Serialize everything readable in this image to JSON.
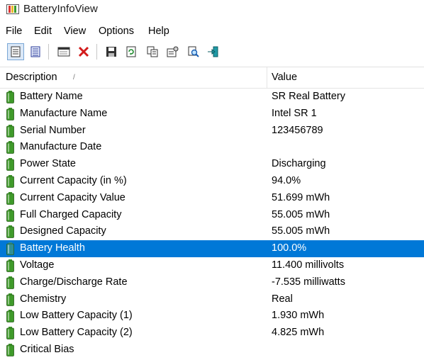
{
  "window": {
    "title": "BatteryInfoView"
  },
  "menu": [
    "File",
    "Edit",
    "View",
    "Options",
    "Help"
  ],
  "toolbar_icons": [
    "html-report-icon",
    "text-report-icon",
    "properties-window-icon",
    "delete-icon",
    "save-icon",
    "refresh-icon",
    "copy-icon",
    "properties-icon",
    "find-icon",
    "exit-icon"
  ],
  "columns": {
    "description": "Description",
    "value": "Value",
    "sort_indicator": "/"
  },
  "rows": [
    {
      "description": "Battery Name",
      "value": "SR Real Battery",
      "selected": false
    },
    {
      "description": "Manufacture Name",
      "value": "Intel SR 1",
      "selected": false
    },
    {
      "description": "Serial Number",
      "value": "123456789",
      "selected": false
    },
    {
      "description": "Manufacture Date",
      "value": "",
      "selected": false
    },
    {
      "description": "Power State",
      "value": "Discharging",
      "selected": false
    },
    {
      "description": "Current Capacity (in %)",
      "value": "94.0%",
      "selected": false
    },
    {
      "description": "Current Capacity Value",
      "value": "51.699 mWh",
      "selected": false
    },
    {
      "description": "Full Charged Capacity",
      "value": "55.005 mWh",
      "selected": false
    },
    {
      "description": "Designed Capacity",
      "value": "55.005 mWh",
      "selected": false
    },
    {
      "description": "Battery Health",
      "value": "100.0%",
      "selected": true
    },
    {
      "description": "Voltage",
      "value": "11.400 millivolts",
      "selected": false
    },
    {
      "description": "Charge/Discharge Rate",
      "value": "-7.535 milliwatts",
      "selected": false
    },
    {
      "description": "Chemistry",
      "value": "Real",
      "selected": false
    },
    {
      "description": "Low Battery Capacity (1)",
      "value": "1.930 mWh",
      "selected": false
    },
    {
      "description": "Low Battery Capacity (2)",
      "value": "4.825 mWh",
      "selected": false
    },
    {
      "description": "Critical Bias",
      "value": "",
      "selected": false
    }
  ],
  "colors": {
    "selection": "#0078d7",
    "battery": "#3f9a2a",
    "battery_selected": "#2f8f94"
  }
}
